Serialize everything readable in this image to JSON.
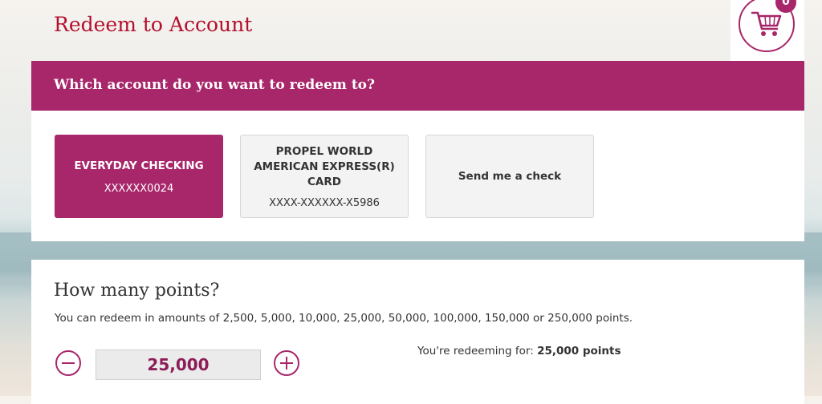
{
  "header": {
    "title": "Redeem to Account",
    "cart_count": "0"
  },
  "account_section": {
    "heading": "Which account do you want to redeem to?",
    "accounts": [
      {
        "name": "EVERYDAY CHECKING",
        "number": "XXXXXX0024",
        "selected": true
      },
      {
        "name_lines": [
          "PROPEL WORLD",
          "AMERICAN EXPRESS(R)",
          "CARD"
        ],
        "number": "XXXX-XXXXXX-X5986",
        "selected": false
      },
      {
        "name": "Send me a check",
        "selected": false
      }
    ]
  },
  "points_section": {
    "heading": "How many points?",
    "help_text": "You can redeem in amounts of 2,500, 5,000, 10,000, 25,000, 50,000, 100,000, 150,000 or 250,000 points.",
    "value": "25,000",
    "summary_label": "You're redeeming for:",
    "summary_value": "25,000 points"
  },
  "colors": {
    "accent": "#a8266a",
    "title_red": "#b30f2e"
  },
  "icons": {
    "cart": "shopping-cart-icon",
    "minus": "minus-circle-icon",
    "plus": "plus-circle-icon"
  }
}
